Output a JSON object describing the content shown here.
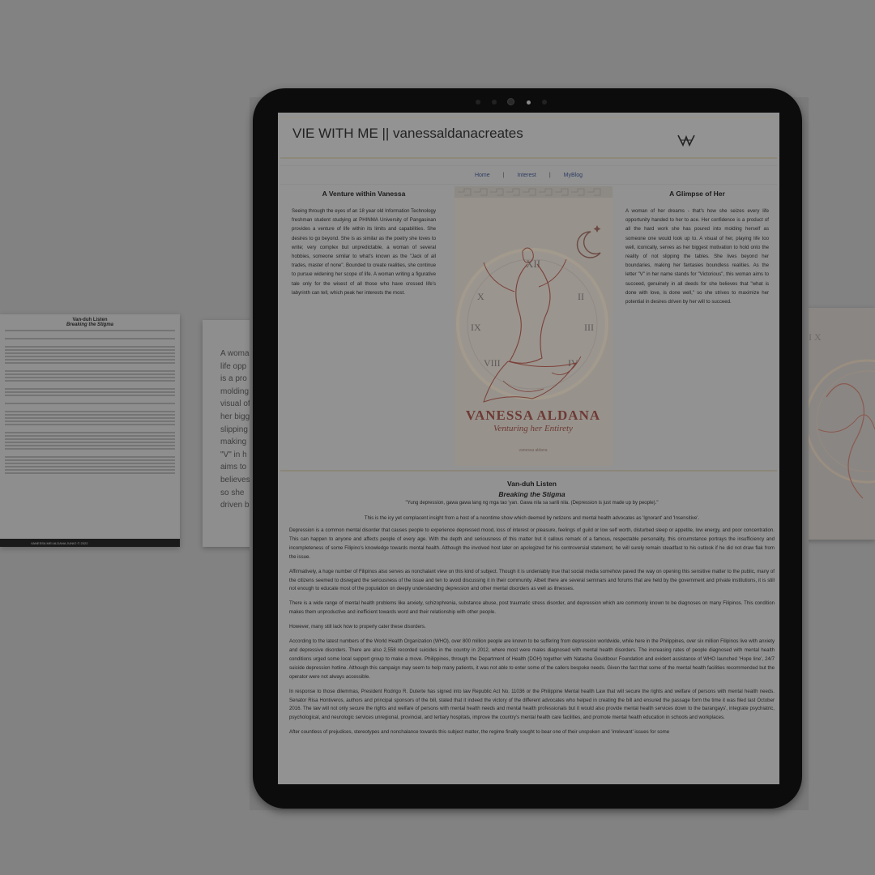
{
  "background_doc": {
    "title": "Van-duh Listen",
    "subtitle": "Breaking the Stigma",
    "footer": "VANESSA MEI ALDANA JUNIO © 2022"
  },
  "background_card": {
    "lines": [
      "A woma",
      "life opp",
      "is a pro",
      "molding",
      "visual of",
      "her bigg",
      "slipping",
      "making",
      "\"V\" in h",
      "aims to",
      "believes",
      "so she",
      "driven b"
    ]
  },
  "site": {
    "title": "VIE WITH ME || vanessaldanacreates",
    "nav": {
      "items": [
        "Home",
        "Interest",
        "MyBlog"
      ],
      "separator": "|"
    },
    "left": {
      "heading": "A Venture within Vanessa",
      "body": "Seeing through the eyes of an 18 year old Information Technology freshman student studying at PHINMA University of Pangasinan provides a venture of life within its limits and capabilities. She desires to go beyond. She is as similar as the poetry she loves to write; very complex but unpredictable, a woman of several hobbies, someone similar to what's known as the \"Jack of all trades, master of none\". Bounded to create realities, she continue to pursue widening her scope of life. A woman writing a figurative tale only for the wisest of all those who have crossed life's labyrinth can tell, which peak her interests the most."
    },
    "cover": {
      "name": "VANESSA ALDANA",
      "tagline": "Venturing her Entirety",
      "small": "vanessa aldana"
    },
    "right": {
      "heading": "A Glimpse of Her",
      "body": "A woman of her dreams - that's how she seizes every life opportunity handed to her to ace. Her confidence is a product of all the hard work she has poured into molding herself as someone one would look up to. A visual of her, playing life too well, iconically, serves as her biggest motivation to hold onto the reality of not slipping the tables. She lives beyond her boundaries, making her fantasies boundless realities. As the letter \"V\" in her name stands for \"Victorious\", this woman aims to succeed, genuinely in all deeds for she believes that \"what is done with love, is done well,\" so she strives to maximize her potential in desires driven by her will to succeed."
    },
    "article": {
      "title": "Van-duh Listen",
      "subtitle": "Breaking the Stigma",
      "quote": "\"Yung depression, gawa gawa lang ng mga tao 'yan. Gawa nila sa sarili nila. (Depression is just made up by people).\"",
      "intro": "This is the icy yet complacent insight from a host of a noontime show which deemed by netizens and mental health advocates as 'Ignorant' and 'Insensitive'.",
      "paragraphs": [
        "Depression is a common mental disorder that causes people to experience depressed mood, loss of interest or pleasure, feelings of guild or low self worth, disturbed sleep or appetite, low energy, and poor concentration. This can happen to anyone and affects people of every age. With the depth and seriousness of this matter but it callous remark of a famous, respectable personality, this circumstance portrays the insufficiency and incompleteness of some Filipino's knowledge towards mental health. Although the involved host later on apologized for his controversial statement, he will surely remain steadfast to his outlook if he did not draw flak from the issue.",
        "Affirmatively, a huge number of Filipinos also serves as nonchalant view on this kind of subject. Though it is undeniably true that social media somehow paved the way on opening this sensitive matter to the public, many of the citizens seemed to disregard the seriousness of the issue and ten to avoid discussing it in their community. Albeit there are several seminars and forums that are held by the government and private institutions, it is still not enough to educate most of the population on deeply understanding depression and other mental disorders as well as illnesses.",
        "There is a wide range of mental health problems like anxiety, schizophrenia, substance abuse, post traumatic stress disorder, and depression which are commonly known to be diagnoses on many Filipinos. This condition makes them unproductive and inefficient towards word and their relationship with other people.",
        "However, many still lack how to properly cater these disorders.",
        "According to the latest numbers of the World Health Organization (WHO), over 800 million people are known to be suffering from depression worldwide, while here in the Philippines, over six million Filipinos live with anxiety and depressive disorders. There are also 2,558 recorded suicides in the country in 2012, where most were males diagnosed with mental health disorders. The increasing rates of people diagnosed with mental health conditions urged some local support group to make a move. Philippines, through the Department of Health (DOH) together with Natasha Gouldbour Foundation and evident assistance of WHO launched 'Hope line', 24/7 suicide depression hotline. Although this campaign may seem to help many patients, it was not able to enter some of the callers bespoke needs. Given the fact that some of the mental health facilities recommended but the operator were not always accessible.",
        "In response to those dilemmas, President Rodrigo R. Duterte has signed into law Republic Act No. 11036 or the Philippine Mental health Law that will secure the rights and welfare of persons with mental health needs. Senator Risa Hontiveros, authors and principal sponsors of the bill, stated that it indeed the victory of the different advocates who helped in creating the bill and ensured the passage form the time it was filed last October 2016. The law will not only secure the rights and welfare of persons with mental health needs and mental health professionals but it would also provide mental health services down to the barangays', integrate psychiatric, psychological, and neurologic services unregional, provincial, and tertiary hospitals, improve the country's mental health care facilities, and promote mental health education in schools and workplaces.",
        "After countless of prejudices, stereotypes and nonchalance towards this subject matter, the regime finally sought to bear one of their unspoken and 'irrelevant' issues for some"
      ]
    }
  }
}
